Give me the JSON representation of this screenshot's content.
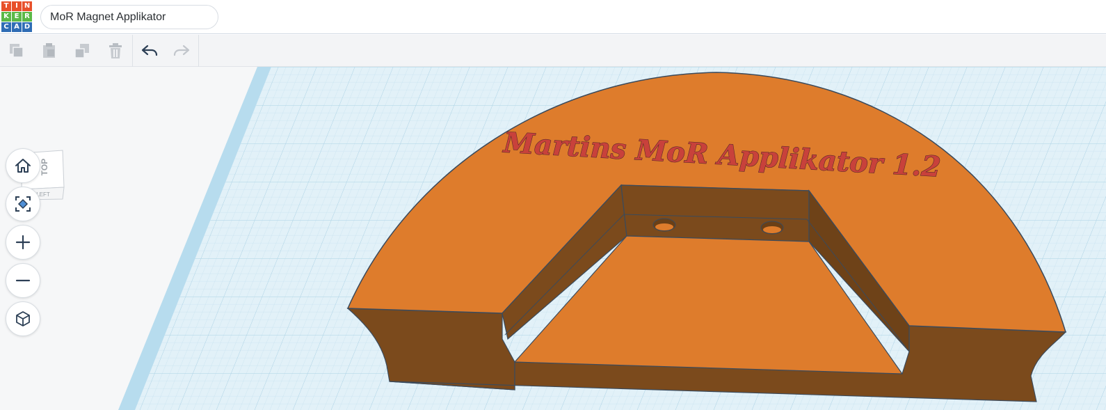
{
  "app": {
    "logo_letters": [
      "T",
      "I",
      "N",
      "K",
      "E",
      "R",
      "C",
      "A",
      "D"
    ],
    "logo_colors": [
      "#e8502a",
      "#e8502a",
      "#e8502a",
      "#5bb947",
      "#5bb947",
      "#5bb947",
      "#2f6db5",
      "#2f6db5",
      "#2f6db5"
    ]
  },
  "header": {
    "design_name": "MoR Magnet Applikator"
  },
  "toolbar": {
    "items": [
      {
        "icon": "copy-icon",
        "enabled": false
      },
      {
        "icon": "paste-icon",
        "enabled": false
      },
      {
        "icon": "duplicate-icon",
        "enabled": false
      },
      {
        "icon": "delete-icon",
        "enabled": false
      },
      {
        "icon": "undo-icon",
        "enabled": true
      },
      {
        "icon": "redo-icon",
        "enabled": false
      }
    ]
  },
  "viewcube": {
    "top_label": "TOP",
    "left_label": "LEFT"
  },
  "nav": {
    "buttons": [
      {
        "icon": "home-icon"
      },
      {
        "icon": "fit-view-icon"
      },
      {
        "icon": "zoom-in-icon"
      },
      {
        "icon": "zoom-out-icon"
      },
      {
        "icon": "perspective-icon"
      }
    ]
  },
  "model": {
    "engraved_text": "Martins MoR Applikator 1.2"
  },
  "colors": {
    "grid_bg": "#dff0f8",
    "grid_line": "#b9d9ea",
    "body_top": "#de7c2c",
    "body_side": "#7a4a1c",
    "text_fill": "#c8413b",
    "accent": "#2f6db5"
  }
}
